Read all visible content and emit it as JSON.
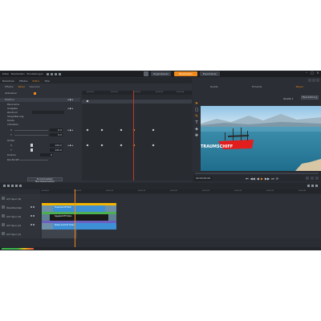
{
  "titlebar": {
    "items": [
      "Datei",
      "Bearbeiten",
      "Einstellungen"
    ]
  },
  "modes": [
    "Organisieren",
    "Bearbeiten",
    "Exportieren"
  ],
  "left_panel": {
    "tabs": [
      "Bibliothek",
      "Effekte",
      "Editor",
      "Titel"
    ],
    "subtabs": [
      "Effekte",
      "Panel",
      "Szenario"
    ],
    "properties": [
      {
        "label": "Aktivieren"
      },
      {
        "label": "Position"
      },
      {
        "label": "Panorama"
      },
      {
        "label": "Ausgabe"
      },
      {
        "label": "Zentrum"
      },
      {
        "label": "Vergrößerung"
      },
      {
        "label": "Kante"
      },
      {
        "label": "Y-Position"
      },
      {
        "label": "X",
        "value": "0.0"
      },
      {
        "label": "Y",
        "value": "0.0"
      },
      {
        "label": "Größe"
      },
      {
        "label": "X",
        "value": "100.0"
      },
      {
        "label": "Y",
        "value": "100.0"
      },
      {
        "label": "Drehen",
        "value": "0"
      },
      {
        "label": "Deckkraft"
      }
    ],
    "reset_label": "Zurücksetzen Nachbearbeiten",
    "ruler": [
      "00:00:00",
      "00:00:01",
      "00:00:02",
      "00:00:03",
      "00:00:04"
    ]
  },
  "player": {
    "tabs": [
      "Quelle",
      "Timeline",
      "Player"
    ],
    "source_label": "Quelle 1",
    "dropdown": "Bearbeitung",
    "overlay_text": "TRAUMSCHIFF",
    "timecode": "00:00:09:06",
    "transport": [
      "⏮",
      "◀◀",
      "◀",
      "▶",
      "▶▶",
      "⏭",
      "⟳"
    ]
  },
  "timeline": {
    "ruler": [
      "00:00:00",
      "00:00:05",
      "00:00:10",
      "00:00:15",
      "00:00:20",
      "00:00:25",
      "00:00:30",
      "00:00:35",
      "00:00:40"
    ],
    "tracks": [
      {
        "name": "A/V Spur (4)"
      },
      {
        "name": "Überblenden"
      },
      {
        "name": "A/V Spur (3)"
      },
      {
        "name": "A/V Spur (2)"
      },
      {
        "name": "A/V Spur (1)"
      }
    ],
    "clips": {
      "title_clip": "Traumschiff Titel",
      "video_clip_1": "Segelschiff Video",
      "video_clip_2": "Küste Ansicht Video"
    }
  },
  "colors": {
    "accent": "#f08a1c",
    "clip_yellow": "#f4b400",
    "clip_blue": "#3e90d6",
    "clip_green": "#4caf50",
    "clip_purple": "#6b5fbf"
  }
}
